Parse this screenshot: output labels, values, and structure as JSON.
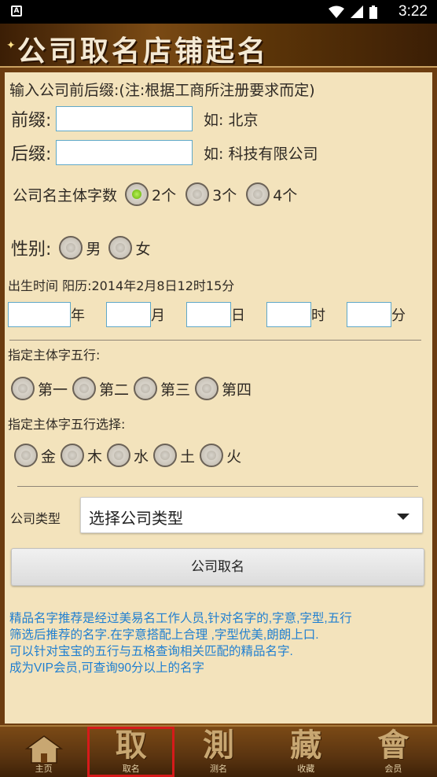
{
  "status_bar": {
    "app_icon": "A",
    "time": "3:22"
  },
  "header": {
    "title": "公司取名店铺起名"
  },
  "form": {
    "intro": "输入公司前后缀:(注:根据工商所注册要求而定)",
    "prefix": {
      "label": "前缀:",
      "value": "",
      "hint": "如: 北京"
    },
    "suffix": {
      "label": "后缀:",
      "value": "",
      "hint": "如: 科技有限公司"
    },
    "char_count": {
      "label": "公司名主体字数",
      "options": [
        "2个",
        "3个",
        "4个"
      ],
      "selected": "2个"
    },
    "gender": {
      "label": "性别:",
      "options": [
        "男",
        "女"
      ]
    },
    "birth": {
      "label": "出生时间 阳历:2014年2月8日12时15分",
      "year_unit": "年",
      "month_unit": "月",
      "day_unit": "日",
      "hour_unit": "时",
      "minute_unit": "分",
      "year": "",
      "month": "",
      "day": "",
      "hour": "",
      "minute": ""
    },
    "element_position": {
      "label": "指定主体字五行:",
      "options": [
        "第一",
        "第二",
        "第三",
        "第四"
      ]
    },
    "element_choice": {
      "label": "指定主体字五行选择:",
      "options": [
        "金",
        "木",
        "水",
        "土",
        "火"
      ]
    },
    "company_type": {
      "label": "公司类型",
      "selected": "选择公司类型"
    },
    "submit_label": "公司取名"
  },
  "description": [
    "精品名字推荐是经过美易名工作人员,针对名字的,字意,字型,五行",
    "筛选后推荐的名字.在字意搭配上合理 ,字型优美,朗朗上口.",
    "可以针对宝宝的五行与五格查询相关匹配的精品名字.",
    "成为VIP会员,可查询90分以上的名字"
  ],
  "tabs": [
    {
      "glyph": "",
      "label": "主页",
      "icon": "home-icon"
    },
    {
      "glyph": "取",
      "label": "取名",
      "icon": "naming-icon",
      "active": true
    },
    {
      "glyph": "測",
      "label": "测名",
      "icon": "test-name-icon"
    },
    {
      "glyph": "藏",
      "label": "收藏",
      "icon": "favorites-icon"
    },
    {
      "glyph": "會",
      "label": "会员",
      "icon": "member-icon"
    }
  ],
  "colors": {
    "panel": "#f3e3bc",
    "description": "#1f7fd1",
    "active_tab_outline": "#d61a1a",
    "radio_checked": "#7bc21c"
  }
}
